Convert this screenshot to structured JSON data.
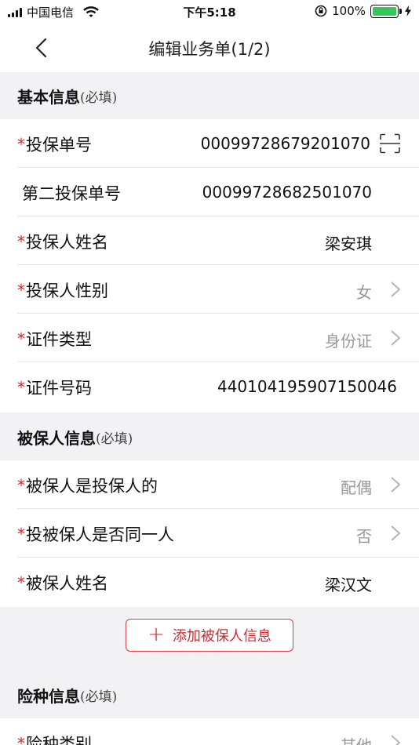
{
  "status_bar": {
    "carrier": "中国电信",
    "time": "下午5:18",
    "battery_percent": "100%",
    "battery_level": 1.0
  },
  "nav": {
    "title": "编辑业务单(1/2)"
  },
  "sections": {
    "basic": {
      "title": "基本信息",
      "required": "(必填)"
    },
    "insured": {
      "title": "被保人信息",
      "required": "(必填)"
    },
    "insurance": {
      "title": "险种信息",
      "required": "(必填)"
    }
  },
  "basic_rows": [
    {
      "required": true,
      "label": "投保单号",
      "value": "00099728679201070"
    },
    {
      "required": false,
      "label": "第二投保单号",
      "value": "00099728682501070"
    },
    {
      "required": true,
      "label": "投保人姓名",
      "value": "梁安琪"
    },
    {
      "required": true,
      "label": "投保人性别",
      "value": "女"
    },
    {
      "required": true,
      "label": "证件类型",
      "value": "身份证"
    },
    {
      "required": true,
      "label": "证件号码",
      "value": "440104195907150046"
    }
  ],
  "insured_rows": [
    {
      "required": true,
      "label": "被保人是投保人的",
      "value": "配偶"
    },
    {
      "required": true,
      "label": "投被保人是否同一人",
      "value": "否"
    },
    {
      "required": true,
      "label": "被保人姓名",
      "value": "梁汉文"
    }
  ],
  "add_insured_button": {
    "plus": "+",
    "label": "添加被保人信息"
  },
  "insurance_rows": [
    {
      "required": true,
      "label": "险种类别",
      "value": "其他"
    }
  ],
  "star": "*",
  "colors": {
    "accent": "#e0252b",
    "value_gray": "#999999",
    "background": "#f2f2f4"
  }
}
